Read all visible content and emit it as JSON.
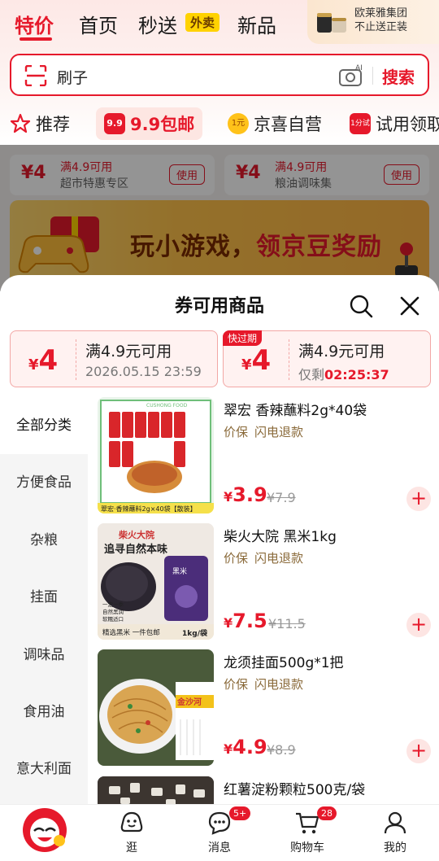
{
  "header": {
    "tabs": [
      "特价",
      "首页",
      "秒送",
      "新品"
    ],
    "waimai_badge": "外卖",
    "brand_ad": {
      "line1": "欧莱雅集团",
      "line2": "不止送正装"
    }
  },
  "search": {
    "value": "刷子",
    "button": "搜索",
    "camera_badge": "AI"
  },
  "categories": [
    {
      "label": "推荐",
      "icon": "star-icon"
    },
    {
      "label": "9.9包邮",
      "badge": "9.9",
      "selected": true
    },
    {
      "label": "京喜自营",
      "badge": "1元"
    },
    {
      "label": "试用领取",
      "badge": "1分试"
    }
  ],
  "background": {
    "coupons": [
      {
        "amount": "¥4",
        "condition": "满4.9可用",
        "scope": "超市特惠专区",
        "action": "使用"
      },
      {
        "amount": "¥4",
        "condition": "满4.9可用",
        "scope": "粮油调味集",
        "action": "使用"
      }
    ],
    "banner_a": "玩小游戏，",
    "banner_b": "领京豆奖励"
  },
  "sheet": {
    "title": "券可用商品",
    "coupons": [
      {
        "symbol": "¥",
        "value": "4",
        "condition": "满4.9元可用",
        "sub": "2026.05.15 23:59"
      },
      {
        "tag": "快过期",
        "symbol": "¥",
        "value": "4",
        "condition": "满4.9元可用",
        "sub_prefix": "仅剩",
        "sub_time": "02:25:37"
      }
    ],
    "side_categories": [
      "全部分类",
      "方便食品",
      "杂粮",
      "挂面",
      "调味品",
      "食用油",
      "意大利面"
    ],
    "products": [
      {
        "name": "翠宏 香辣蘸料2g*40袋",
        "tags": [
          "价保",
          "闪电退款"
        ],
        "symbol": "¥",
        "price": "3.9",
        "original": "¥7.9",
        "image_caption": "翠宏·香辣蘸料2g×40袋【散装】",
        "image_brand": "CUSHONG FOOD"
      },
      {
        "name": "柴火大院 黑米1kg",
        "tags": [
          "价保",
          "闪电退款"
        ],
        "symbol": "¥",
        "price": "7.5",
        "original": "¥11.5",
        "image_brand": "柴火大院",
        "image_slogan": "追寻自然本味",
        "image_caption": "精选黑米 一件包邮",
        "image_weight": "1kg/袋",
        "image_bag": "黑米",
        "image_points": [
          "一定一季",
          "自然黑润",
          "软糯适口"
        ]
      },
      {
        "name": "龙须挂面500g*1把",
        "tags": [
          "价保",
          "闪电退款"
        ],
        "symbol": "¥",
        "price": "4.9",
        "original": "¥8.9",
        "image_brand": "金沙河"
      },
      {
        "name": "红薯淀粉颗粒500克/袋",
        "tags": [],
        "symbol": "",
        "price": "",
        "original": ""
      }
    ]
  },
  "tabbar": [
    {
      "label": "",
      "icon": "jd-mascot-icon"
    },
    {
      "label": "逛",
      "icon": "browse-icon"
    },
    {
      "label": "消息",
      "icon": "message-icon",
      "badge": "5+"
    },
    {
      "label": "购物车",
      "icon": "cart-icon",
      "badge": "28"
    },
    {
      "label": "我的",
      "icon": "profile-icon"
    }
  ],
  "colors": {
    "accent": "#e6192b",
    "tag_text": "#8a6a3a",
    "coupon_bg": "#fff2f1"
  }
}
